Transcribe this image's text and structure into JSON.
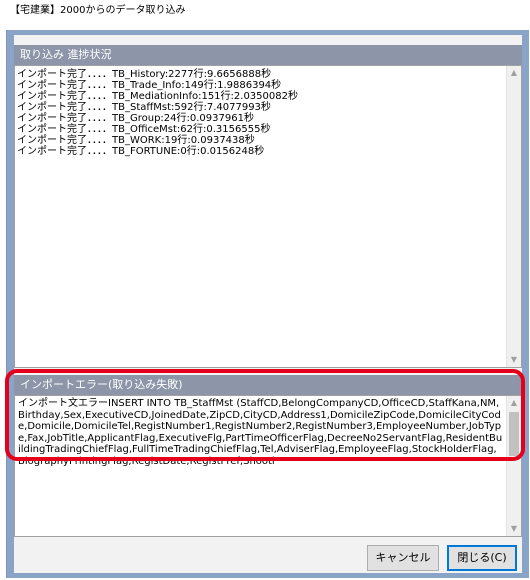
{
  "window": {
    "title": "【宅建業】2000からのデータ取り込み"
  },
  "progress_panel": {
    "header": "取り込み 進捗状況",
    "lines": [
      "インポート完了．．．．TB_History:2277行:9.6656888秒",
      "インポート完了．．．．TB_Trade_Info:149行:1.9886394秒",
      "インポート完了．．．．TB_MediationInfo:151行:2.0350082秒",
      "インポート完了．．．．TB_StaffMst:592行:7.4077993秒",
      "インポート完了．．．．TB_Group:24行:0.0937961秒",
      "インポート完了．．．．TB_OfficeMst:62行:0.3156555秒",
      "インポート完了．．．．TB_WORK:19行:0.0937438秒",
      "インポート完了．．．．TB_FORTUNE:0行:0.0156248秒"
    ]
  },
  "error_panel": {
    "header": "インポートエラー(取り込み失敗)",
    "text": "インポート文エラーINSERT INTO TB_StaffMst (StaffCD,BelongCompanyCD,OfficeCD,StaffKana,NM,Birthday,Sex,ExecutiveCD,JoinedDate,ZipCD,CityCD,Address1,DomicileZipCode,DomicileCityCode,Domicile,DomicileTel,RegistNumber1,RegistNumber2,RegistNumber3,EmployeeNumber,JobType,Fax,JobTitle,ApplicantFlag,ExecutiveFlg,PartTimeOfficerFlag,DecreeNo2ServantFlag,ResidentBuildingTradingChiefFlag,FullTimeTradingChiefFlag,Tel,AdviserFlag,EmployeeFlag,StockHolderFlag,BiographyPrintingFlag,RegistDate,RegistPref,Shooti"
  },
  "buttons": {
    "cancel": "キャンセル",
    "close": "閉じる(C)"
  },
  "colors": {
    "panel_header_bg": "#8c96a8",
    "highlight_border": "#e4001b",
    "client_bg": "#8aa4c8"
  }
}
